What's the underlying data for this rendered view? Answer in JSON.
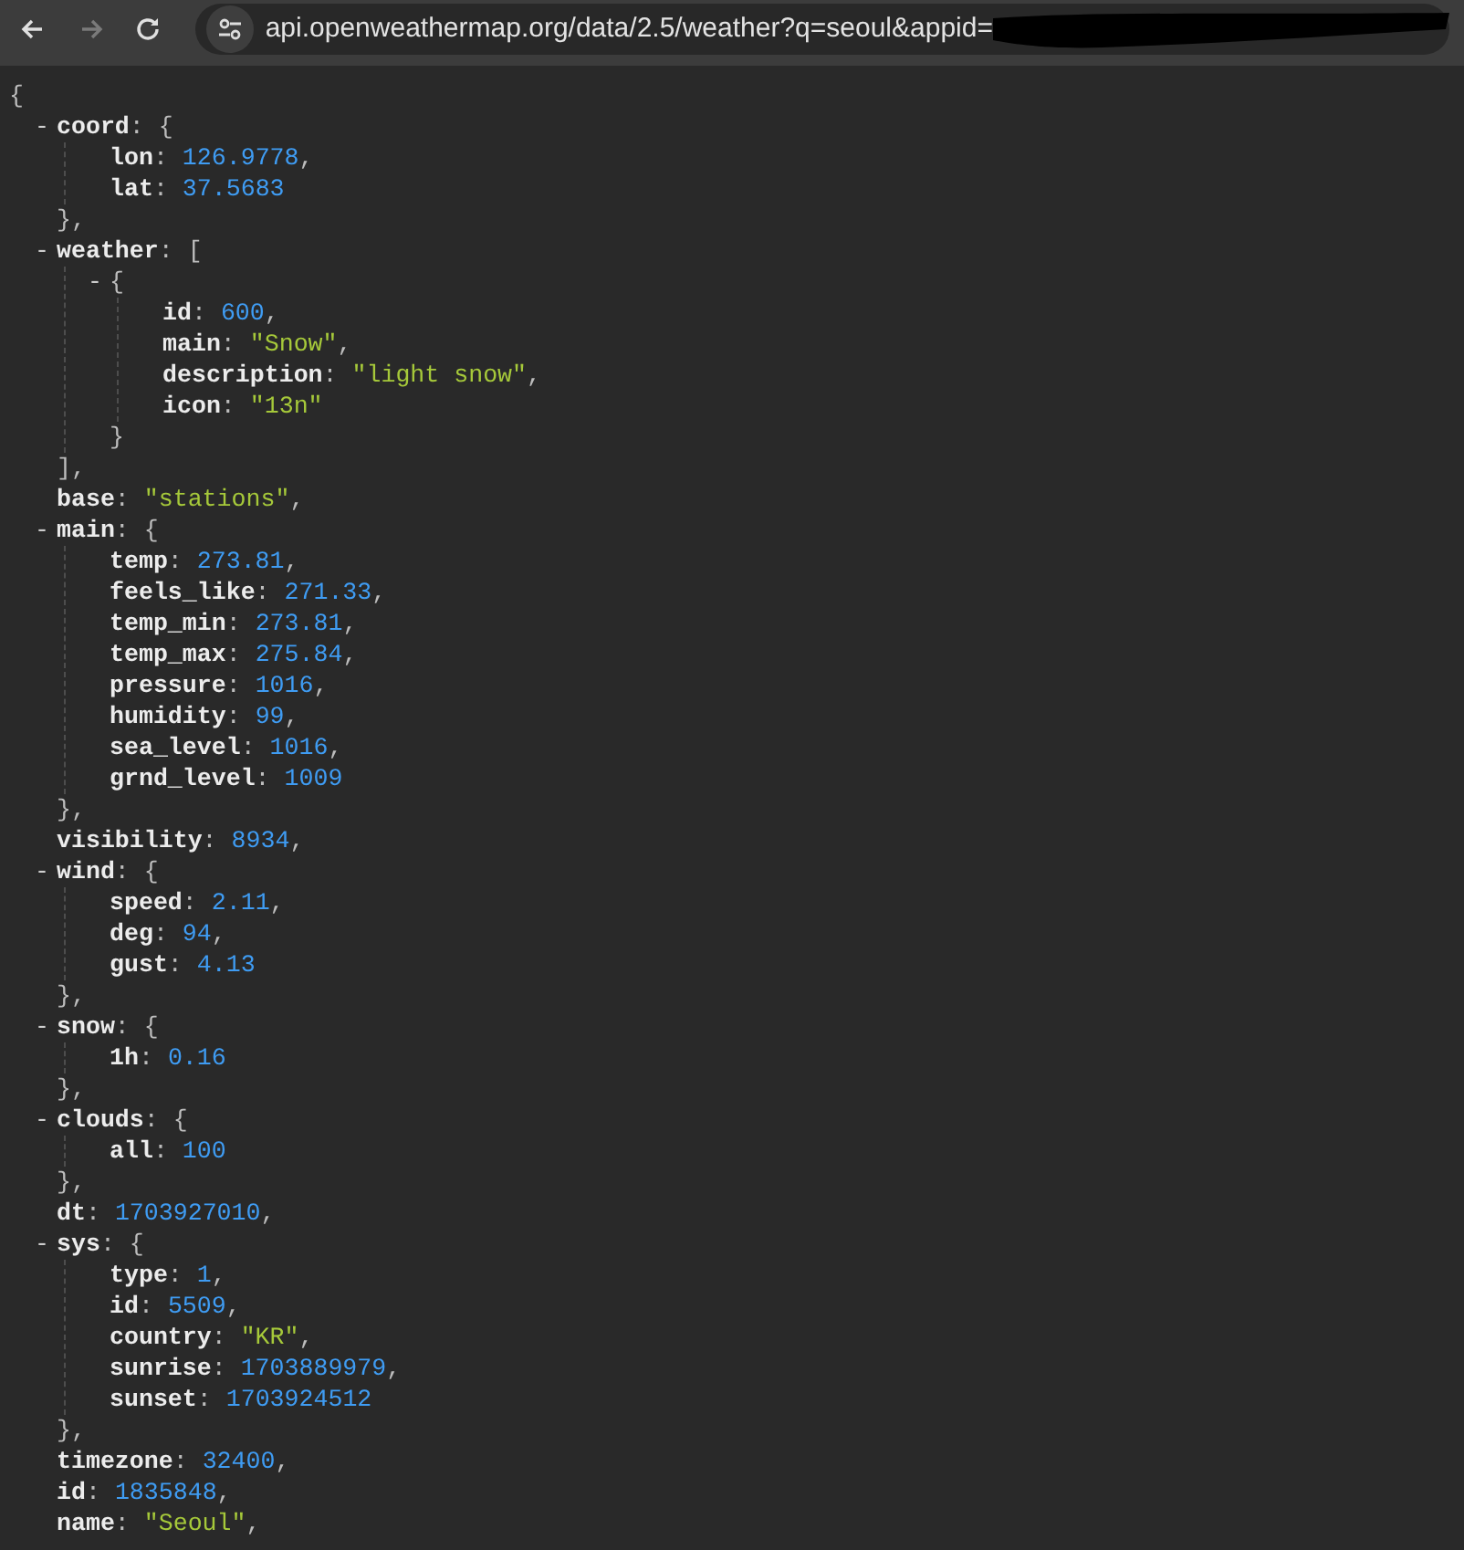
{
  "browser": {
    "nav_buttons": [
      {
        "kind": "back",
        "disabled": false
      },
      {
        "kind": "forward",
        "disabled": true
      },
      {
        "kind": "reload",
        "disabled": false
      }
    ],
    "url": "api.openweathermap.org/data/2.5/weather?q=seoul&appid=",
    "redacted": true
  },
  "json_view": {
    "open": "{",
    "children": [
      {
        "toggle": "-",
        "key": "coord",
        "sep": ":",
        "open": "{",
        "close": "},",
        "children": [
          {
            "key": "lon",
            "sep": ":",
            "value": "126.9778",
            "kind": "number",
            "end": ","
          },
          {
            "key": "lat",
            "sep": ":",
            "value": "37.5683",
            "kind": "number"
          }
        ]
      },
      {
        "toggle": "-",
        "key": "weather",
        "sep": ":",
        "open": "[",
        "close": "],",
        "children": [
          {
            "toggle": "-",
            "open": "{",
            "close": "}",
            "children": [
              {
                "key": "id",
                "sep": ":",
                "value": "600",
                "kind": "number",
                "end": ","
              },
              {
                "key": "main",
                "sep": ":",
                "value": "\"Snow\"",
                "kind": "string",
                "end": ","
              },
              {
                "key": "description",
                "sep": ":",
                "value": "\"light snow\"",
                "kind": "string",
                "end": ","
              },
              {
                "key": "icon",
                "sep": ":",
                "value": "\"13n\"",
                "kind": "string"
              }
            ]
          }
        ]
      },
      {
        "key": "base",
        "sep": ":",
        "value": "\"stations\"",
        "kind": "string",
        "end": ","
      },
      {
        "toggle": "-",
        "key": "main",
        "sep": ":",
        "open": "{",
        "close": "},",
        "children": [
          {
            "key": "temp",
            "sep": ":",
            "value": "273.81",
            "kind": "number",
            "end": ","
          },
          {
            "key": "feels_like",
            "sep": ":",
            "value": "271.33",
            "kind": "number",
            "end": ","
          },
          {
            "key": "temp_min",
            "sep": ":",
            "value": "273.81",
            "kind": "number",
            "end": ","
          },
          {
            "key": "temp_max",
            "sep": ":",
            "value": "275.84",
            "kind": "number",
            "end": ","
          },
          {
            "key": "pressure",
            "sep": ":",
            "value": "1016",
            "kind": "number",
            "end": ","
          },
          {
            "key": "humidity",
            "sep": ":",
            "value": "99",
            "kind": "number",
            "end": ","
          },
          {
            "key": "sea_level",
            "sep": ":",
            "value": "1016",
            "kind": "number",
            "end": ","
          },
          {
            "key": "grnd_level",
            "sep": ":",
            "value": "1009",
            "kind": "number"
          }
        ]
      },
      {
        "key": "visibility",
        "sep": ":",
        "value": "8934",
        "kind": "number",
        "end": ","
      },
      {
        "toggle": "-",
        "key": "wind",
        "sep": ":",
        "open": "{",
        "close": "},",
        "children": [
          {
            "key": "speed",
            "sep": ":",
            "value": "2.11",
            "kind": "number",
            "end": ","
          },
          {
            "key": "deg",
            "sep": ":",
            "value": "94",
            "kind": "number",
            "end": ","
          },
          {
            "key": "gust",
            "sep": ":",
            "value": "4.13",
            "kind": "number"
          }
        ]
      },
      {
        "toggle": "-",
        "key": "snow",
        "sep": ":",
        "open": "{",
        "close": "},",
        "children": [
          {
            "key": "1h",
            "sep": ":",
            "value": "0.16",
            "kind": "number"
          }
        ]
      },
      {
        "toggle": "-",
        "key": "clouds",
        "sep": ":",
        "open": "{",
        "close": "},",
        "children": [
          {
            "key": "all",
            "sep": ":",
            "value": "100",
            "kind": "number"
          }
        ]
      },
      {
        "key": "dt",
        "sep": ":",
        "value": "1703927010",
        "kind": "number",
        "end": ","
      },
      {
        "toggle": "-",
        "key": "sys",
        "sep": ":",
        "open": "{",
        "close": "},",
        "children": [
          {
            "key": "type",
            "sep": ":",
            "value": "1",
            "kind": "number",
            "end": ","
          },
          {
            "key": "id",
            "sep": ":",
            "value": "5509",
            "kind": "number",
            "end": ","
          },
          {
            "key": "country",
            "sep": ":",
            "value": "\"KR\"",
            "kind": "string",
            "end": ","
          },
          {
            "key": "sunrise",
            "sep": ":",
            "value": "1703889979",
            "kind": "number",
            "end": ","
          },
          {
            "key": "sunset",
            "sep": ":",
            "value": "1703924512",
            "kind": "number"
          }
        ]
      },
      {
        "key": "timezone",
        "sep": ":",
        "value": "32400",
        "kind": "number",
        "end": ","
      },
      {
        "key": "id",
        "sep": ":",
        "value": "1835848",
        "kind": "number",
        "end": ","
      },
      {
        "key": "name",
        "sep": ":",
        "value": "\"Seoul\"",
        "kind": "string",
        "end": ","
      }
    ]
  }
}
